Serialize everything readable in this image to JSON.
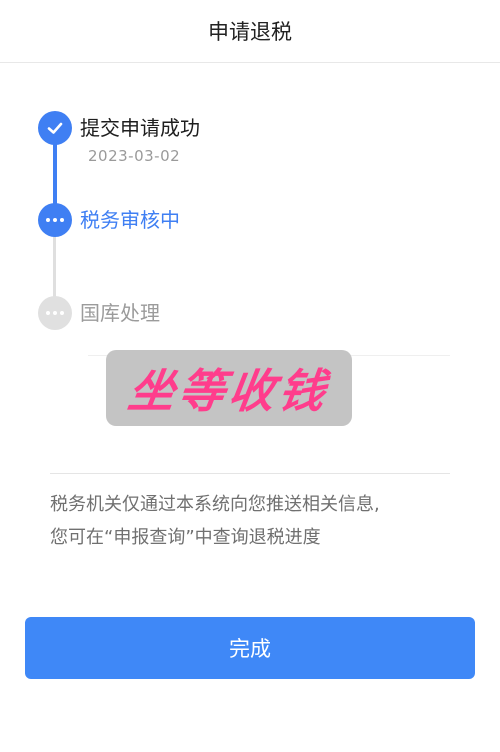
{
  "header": {
    "title": "申请退税"
  },
  "steps": [
    {
      "label": "提交申请成功",
      "date": "2023-03-02",
      "status": "done"
    },
    {
      "label": "税务审核中",
      "status": "active"
    },
    {
      "label": "国库处理",
      "status": "pending"
    }
  ],
  "sticker": {
    "text": "坐等收钱"
  },
  "notice": {
    "line1": "税务机关仅通过本系统向您推送相关信息,",
    "line2": "您可在“申报查询”中查询退税进度"
  },
  "footer": {
    "done_label": "完成"
  },
  "colors": {
    "accent": "#3f7ff3",
    "button": "#3f88f7",
    "sticker_text": "#ff3d8c"
  }
}
